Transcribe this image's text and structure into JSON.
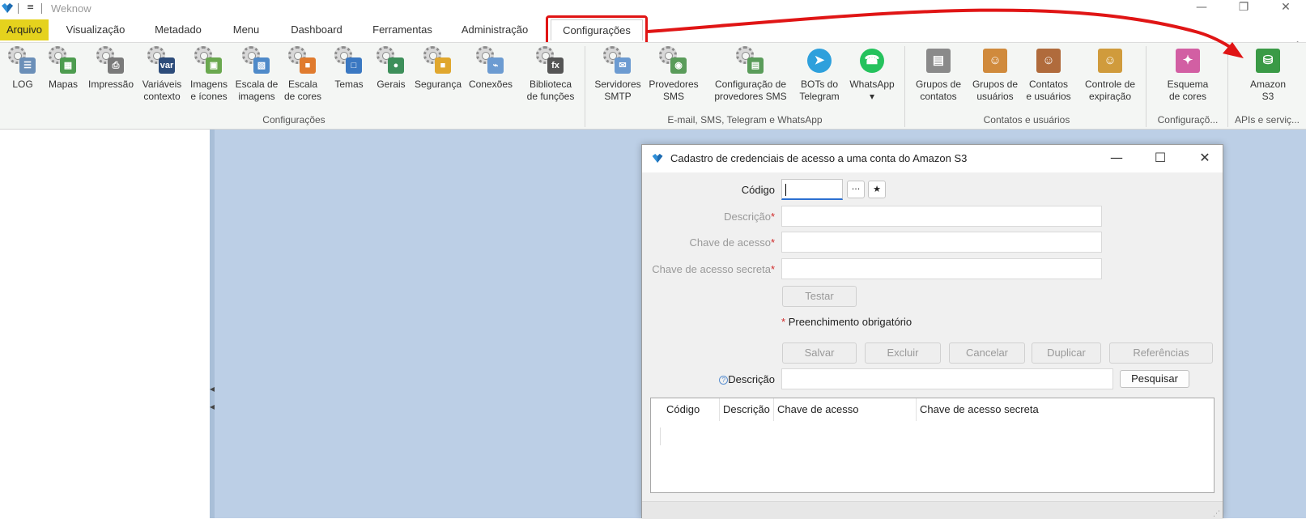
{
  "app": {
    "title": "Weknow",
    "quick_access": "≡"
  },
  "window_controls": {
    "minimize": "—",
    "restore": "❐",
    "close": "✕"
  },
  "tabs": [
    "Arquivo",
    "Visualização",
    "Metadado",
    "Menu",
    "Dashboard",
    "Ferramentas",
    "Administração",
    "Configurações"
  ],
  "active_tab": "Configurações",
  "ribbon": {
    "buttons": [
      {
        "label": "LOG",
        "icon": "log-icon",
        "badge": "☰",
        "color": "#6b8fb8"
      },
      {
        "label": "Mapas",
        "icon": "maps-icon",
        "badge": "▦",
        "color": "#4d9c4f"
      },
      {
        "label": "Impressão",
        "icon": "printer-icon",
        "badge": "⎙",
        "color": "#7a7a7a"
      },
      {
        "label": "Variáveis\ncontexto",
        "icon": "variables-icon",
        "badge": "var",
        "color": "#2d4c7a"
      },
      {
        "label": "Imagens\ne ícones",
        "icon": "images-icon",
        "badge": "▣",
        "color": "#6aa84f"
      },
      {
        "label": "Escala de\nimagens",
        "icon": "image-scale-icon",
        "badge": "▧",
        "color": "#4f8ac9"
      },
      {
        "label": "Escala\nde cores",
        "icon": "color-scale-icon",
        "badge": "■",
        "color": "#e07b2e"
      },
      {
        "label": "Temas",
        "icon": "themes-icon",
        "badge": "□",
        "color": "#3a78c2"
      },
      {
        "label": "Gerais",
        "icon": "general-icon",
        "badge": "●",
        "color": "#3d8f5a"
      },
      {
        "label": "Segurança",
        "icon": "security-lock-icon",
        "badge": "■",
        "color": "#e0a72e"
      },
      {
        "label": "Conexões",
        "icon": "connections-icon",
        "badge": "⌁",
        "color": "#6c9bd1"
      },
      {
        "label": "Biblioteca\nde funções",
        "icon": "function-library-icon",
        "badge": "fx",
        "color": "#555555"
      },
      {
        "label": "Servidores\nSMTP",
        "icon": "smtp-icon",
        "badge": "✉",
        "color": "#6c9bd1"
      },
      {
        "label": "Provedores\nSMS",
        "icon": "sms-provider-icon",
        "badge": "◉",
        "color": "#5a9c5a"
      },
      {
        "label": "Configuração de\nprovedores SMS",
        "icon": "sms-config-icon",
        "badge": "▤",
        "color": "#5a9c5a"
      },
      {
        "label": "BOTs do\nTelegram",
        "icon": "telegram-icon",
        "badge": "➤",
        "color": "#2ea0dc"
      },
      {
        "label": "WhatsApp\n▾",
        "icon": "whatsapp-icon",
        "badge": "☎",
        "color": "#25c25d"
      },
      {
        "label": "Grupos de\ncontatos",
        "icon": "contact-groups-icon",
        "badge": "▤",
        "color": "#8a8a8a"
      },
      {
        "label": "Grupos de\nusuários",
        "icon": "user-groups-icon",
        "badge": "☺",
        "color": "#d08a3c"
      },
      {
        "label": "Contatos\ne usuários",
        "icon": "contacts-users-icon",
        "badge": "☺",
        "color": "#b06b3c"
      },
      {
        "label": "Controle de\nexpiração",
        "icon": "expiration-control-icon",
        "badge": "☺",
        "color": "#d09b3c"
      },
      {
        "label": "Esquema\nde cores",
        "icon": "color-scheme-icon",
        "badge": "✦",
        "color": "#d25fa3"
      },
      {
        "label": "Amazon\nS3",
        "icon": "amazon-s3-icon",
        "badge": "⛁",
        "color": "#3a9a46"
      }
    ],
    "groups": [
      "Configurações",
      "E-mail, SMS, Telegram e WhatsApp",
      "Contatos e usuários",
      "Configuraçõ...",
      "APIs e serviç..."
    ]
  },
  "dialog": {
    "title": "Cadastro de credenciais de acesso a uma conta do Amazon S3",
    "controls": {
      "minimize": "—",
      "maximize": "☐",
      "close": "✕"
    },
    "fields": {
      "codigo": {
        "label": "Código",
        "value": ""
      },
      "descricao": {
        "label": "Descrição",
        "required_mark": "*",
        "value": ""
      },
      "chave_acesso": {
        "label": "Chave de acesso",
        "required_mark": "*",
        "value": ""
      },
      "chave_secreta": {
        "label": "Chave de acesso secreta",
        "required_mark": "*",
        "value": ""
      }
    },
    "lookup_button": "···",
    "new_button": "★",
    "test_button": "Testar",
    "required_note": {
      "mark": "*",
      "text": "Preenchimento obrigatório"
    },
    "actions": [
      "Salvar",
      "Excluir",
      "Cancelar",
      "Duplicar",
      "Referências"
    ],
    "search": {
      "help_icon": "?",
      "label": "Descrição",
      "value": "",
      "button": "Pesquisar"
    },
    "grid": {
      "columns": [
        "Código",
        "Descrição",
        "Chave de acesso",
        "Chave de acesso secreta"
      ],
      "rows": []
    },
    "resize_grip": "⋰"
  }
}
